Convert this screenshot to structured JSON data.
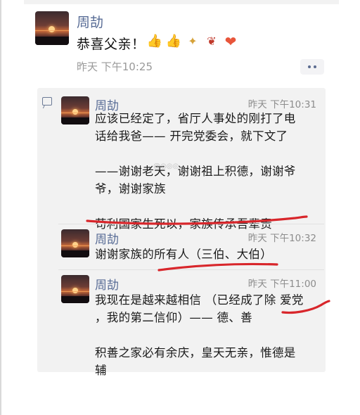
{
  "post": {
    "author": "周劼",
    "text": "恭喜父亲！",
    "emojis": [
      "thumbs-up-icon",
      "thumbs-up-icon",
      "party-popper-icon",
      "rose-icon",
      "heart-icon"
    ],
    "time": "昨天 下午10:25"
  },
  "comments": [
    {
      "author": "周劼",
      "time": "昨天 下午10:31",
      "text": "应该已经定了，省厅人事处的刚打了电\n话给我爸—— 开完党委会，就下文了\n\n——谢谢老天，谢谢祖上积德，谢谢爷\n爷，谢谢家族\n\n苟利国家生死以，家族传承吾辈责"
    },
    {
      "author": "周劼",
      "time": "昨天 下午10:32",
      "text": "谢谢家族的所有人（三伯、大伯）"
    },
    {
      "author": "周劼",
      "time": "昨天 下午11:00",
      "text": "我现在是越来越相信 （已经成了除 爱党\n，我的第二信仰）—— 德、善\n\n积善之家必有余庆，皇天无亲，惟德是\n辅"
    }
  ],
  "colors": {
    "name_link": "#576b95",
    "annotation_red": "#d8262b",
    "comment_bg": "#f2f2f2"
  }
}
